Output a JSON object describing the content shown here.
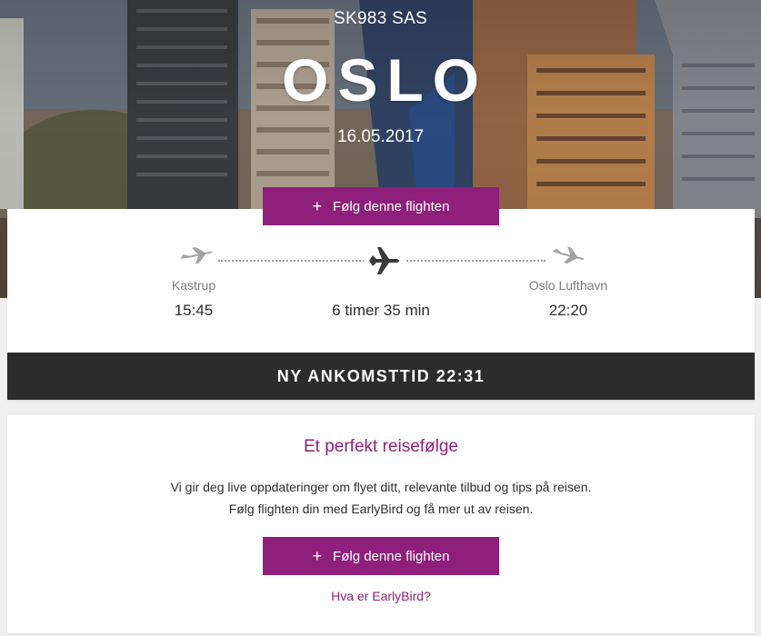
{
  "hero": {
    "flight_code": "SK983 SAS",
    "city": "OSLO",
    "date": "16.05.2017"
  },
  "follow_button": {
    "plus_icon": "+",
    "label": "Følg denne flighten"
  },
  "flight": {
    "departure": {
      "airport": "Kastrup",
      "time": "15:45"
    },
    "arrival": {
      "airport": "Oslo Lufthavn",
      "time": "22:20"
    },
    "duration": "6 timer 35 min",
    "new_arrival": "NY ANKOMSTTID 22:31",
    "icons": {
      "departure": "plane-takeoff-icon",
      "in_flight": "plane-icon",
      "arrival": "plane-landing-icon"
    }
  },
  "info": {
    "title": "Et perfekt reisefølge",
    "line1": "Vi gir deg live oppdateringer om flyet ditt, relevante tilbud og tips på reisen.",
    "line2": "Følg flighten din med EarlyBird og få mer ut av reisen.",
    "link": "Hva er EarlyBird?"
  },
  "colors": {
    "accent": "#8e1f7a",
    "dark_bar": "#2c2c2c",
    "icon_gray": "#9a9a9a"
  }
}
